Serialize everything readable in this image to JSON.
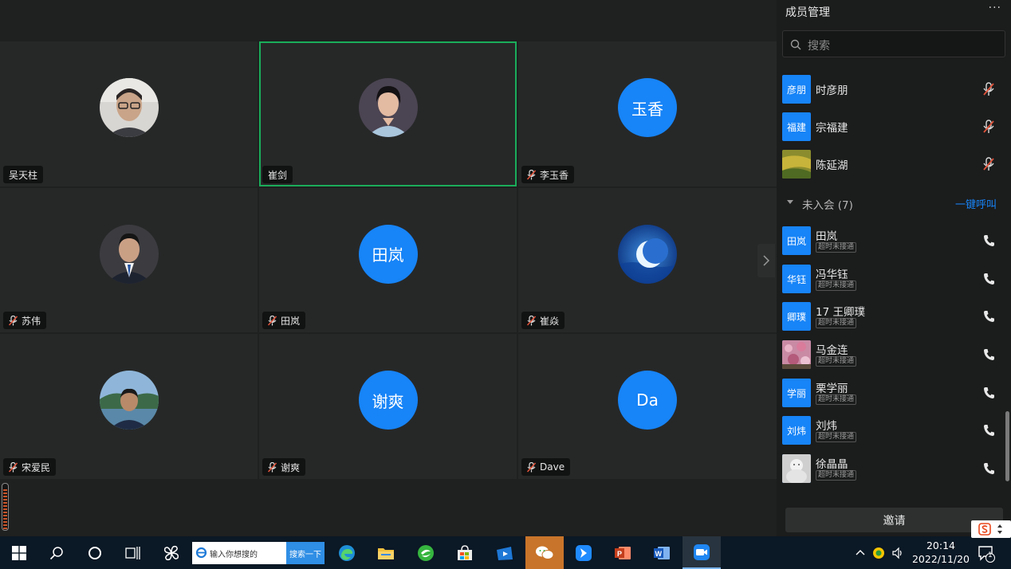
{
  "tiles": [
    {
      "name": "吴天柱",
      "avatar_text": "",
      "photo": true,
      "muted": false,
      "active": false
    },
    {
      "name": "崔剑",
      "avatar_text": "",
      "photo": true,
      "muted": false,
      "active": true
    },
    {
      "name": "李玉香",
      "avatar_text": "玉香",
      "photo": false,
      "muted": true,
      "active": false
    },
    {
      "name": "苏伟",
      "avatar_text": "",
      "photo": true,
      "muted": true,
      "active": false
    },
    {
      "name": "田岚",
      "avatar_text": "田岚",
      "photo": false,
      "muted": true,
      "active": false
    },
    {
      "name": "崔焱",
      "avatar_text": "",
      "photo": true,
      "muted": true,
      "active": false
    },
    {
      "name": "宋爱民",
      "avatar_text": "",
      "photo": true,
      "muted": true,
      "active": false
    },
    {
      "name": "谢爽",
      "avatar_text": "谢爽",
      "photo": false,
      "muted": true,
      "active": false
    },
    {
      "name": "Dave",
      "avatar_text": "Da",
      "photo": false,
      "muted": true,
      "active": false
    }
  ],
  "panel": {
    "title": "成员管理",
    "more": "···",
    "search_placeholder": "搜索",
    "joined": [
      {
        "avatar_text": "彦朋",
        "name": "时彦朋",
        "status_icon": "mic-muted-icon"
      },
      {
        "avatar_text": "福建",
        "name": "宗福建",
        "status_icon": "mic-muted-icon"
      },
      {
        "avatar_text": "",
        "name": "陈延湖",
        "status_icon": "mic-muted-icon"
      }
    ],
    "not_joined_label": "未入会 (7)",
    "call_all": "一键呼叫",
    "not_joined": [
      {
        "avatar_text": "田岚",
        "name": "田岚",
        "badge": "超时未接通"
      },
      {
        "avatar_text": "华钰",
        "name": "冯华钰",
        "badge": "超时未接通"
      },
      {
        "avatar_text": "卿璞",
        "name": "17 王卿璞",
        "badge": "超时未接通"
      },
      {
        "avatar_text": "",
        "name": "马金连",
        "badge": "超时未接通"
      },
      {
        "avatar_text": "学丽",
        "name": "栗学丽",
        "badge": "超时未接通"
      },
      {
        "avatar_text": "刘炜",
        "name": "刘炜",
        "badge": "超时未接通"
      },
      {
        "avatar_text": "",
        "name": "徐晶晶",
        "badge": "超时未接通"
      }
    ],
    "invite": "邀请"
  },
  "taskbar": {
    "search_text": "输入你想搜的",
    "search_button": "搜索一下",
    "time": "20:14",
    "date": "2022/11/20",
    "notification_count": "1"
  },
  "colors": {
    "accent": "#1784f7",
    "active_speaker": "#1aad5a",
    "taskbar": "#0b1825"
  }
}
